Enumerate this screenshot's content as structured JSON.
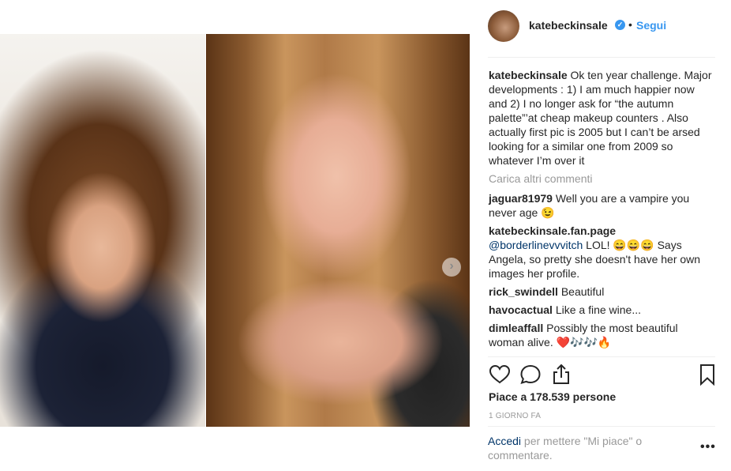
{
  "header": {
    "username": "katebeckinsale",
    "verified_icon": "verified-badge-icon",
    "bullet": "•",
    "follow_label": "Segui"
  },
  "caption": {
    "username": "katebeckinsale",
    "text": "Ok ten year challenge. Major developments : 1) I am much happier now and 2) I no longer ask for “the autumn palette”’at cheap makeup counters . Also actually first pic is 2005 but I can’t be arsed looking for a similar one from 2009 so whatever I’m over it"
  },
  "load_more_label": "Carica altri commenti",
  "comments": [
    {
      "username": "jaguar81979",
      "text": "Well you are a vampire you never age 😉"
    },
    {
      "username": "katebeckinsale.fan.page",
      "mention": "@borderlinevvvitch",
      "text": " LOL! 😄😄😄 Says Angela, so pretty she doesn't have her own images her profile."
    },
    {
      "username": "rick_swindell",
      "text": "Beautiful"
    },
    {
      "username": "havocactual",
      "text": "Like a fine wine..."
    },
    {
      "username": "dimleaffall",
      "text": "Possibly the most beautiful woman alive. ❤️🎶🎶🔥"
    }
  ],
  "actions": {
    "like_icon": "heart-icon",
    "comment_icon": "comment-icon",
    "share_icon": "share-icon",
    "save_icon": "bookmark-icon"
  },
  "likes_text": "Piace a 178.539 persone",
  "timestamp": "1 GIORNO FA",
  "login": {
    "link": "Accedi",
    "rest": " per mettere \"Mi piace\" o commentare."
  },
  "more_options": "•••",
  "carousel_next": "›",
  "colors": {
    "accent": "#3897f0",
    "link_dark": "#003569",
    "muted": "#999999",
    "text": "#262626"
  }
}
